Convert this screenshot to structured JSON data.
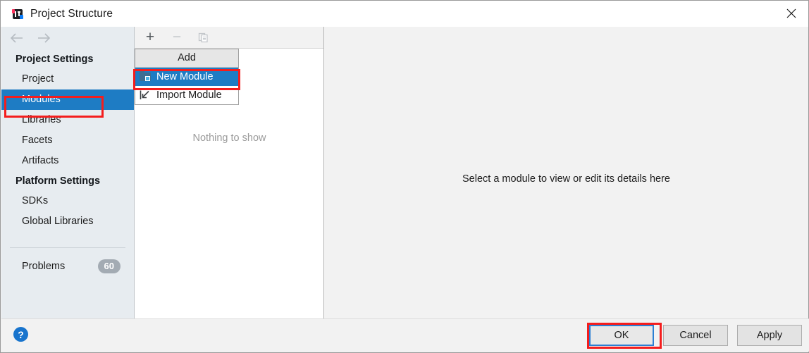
{
  "window": {
    "title": "Project Structure",
    "app_icon": "intellij-idea-icon",
    "close_icon": "close-icon"
  },
  "sidebar": {
    "nav_back_icon": "arrow-left-icon",
    "nav_forward_icon": "arrow-right-icon",
    "sections": [
      {
        "heading": "Project Settings",
        "items": [
          {
            "label": "Project",
            "selected": false
          },
          {
            "label": "Modules",
            "selected": true
          },
          {
            "label": "Libraries",
            "selected": false
          },
          {
            "label": "Facets",
            "selected": false
          },
          {
            "label": "Artifacts",
            "selected": false
          }
        ]
      },
      {
        "heading": "Platform Settings",
        "items": [
          {
            "label": "SDKs",
            "selected": false
          },
          {
            "label": "Global Libraries",
            "selected": false
          }
        ]
      }
    ],
    "problems": {
      "label": "Problems",
      "count": "60"
    }
  },
  "list_panel": {
    "toolbar": {
      "add_label": "+",
      "add_icon": "plus-icon",
      "remove_label": "−",
      "remove_icon": "minus-icon",
      "copy_icon": "copy-icon"
    },
    "empty_text": "Nothing to show"
  },
  "popup_menu": {
    "header": "Add",
    "items": [
      {
        "label": "New Module",
        "icon": "new-module-folder-icon",
        "highlighted": true
      },
      {
        "label": "Import Module",
        "icon": "import-module-icon",
        "highlighted": false
      }
    ]
  },
  "details_panel": {
    "placeholder": "Select a module to view or edit its details here"
  },
  "bottom_bar": {
    "help_label": "?",
    "help_icon": "help-icon",
    "buttons": [
      {
        "label": "OK",
        "focused": true
      },
      {
        "label": "Cancel",
        "focused": false
      },
      {
        "label": "Apply",
        "focused": false
      }
    ]
  },
  "annotations": {
    "color": "#f41d1d",
    "targets": [
      "modules-sidebar-item",
      "new-module-menu-item",
      "ok-button"
    ]
  }
}
